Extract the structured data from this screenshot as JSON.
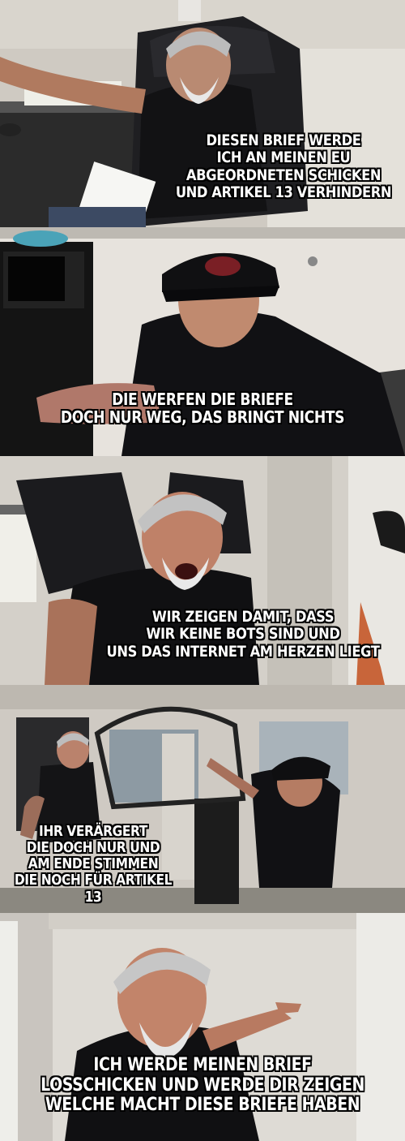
{
  "panels": [
    {
      "caption": "DIESEN BRIEF WERDE\nICH AN MEINEN EU\nABGEORDNETEN SCHICKEN\nUND ARTIKEL 13 VERHINDERN"
    },
    {
      "caption": "DIE WERFEN DIE BRIEFE\nDOCH NUR WEG, DAS BRINGT NICHTS"
    },
    {
      "caption": "WIR ZEIGEN DAMIT, DASS\nWIR KEINE BOTS SIND UND\nUNS DAS INTERNET AM HERZEN LIEGT"
    },
    {
      "caption": "IHR VERÄRGERT\nDIE DOCH NUR UND\nAM ENDE STIMMEN\nDIE NOCH FÜR ARTIKEL 13"
    },
    {
      "caption": "ICH WERDE MEINEN BRIEF\nLOSSCHICKEN UND WERDE DIR ZEIGEN\nWELCHE MACHT DIESE BRIEFE HABEN"
    }
  ]
}
